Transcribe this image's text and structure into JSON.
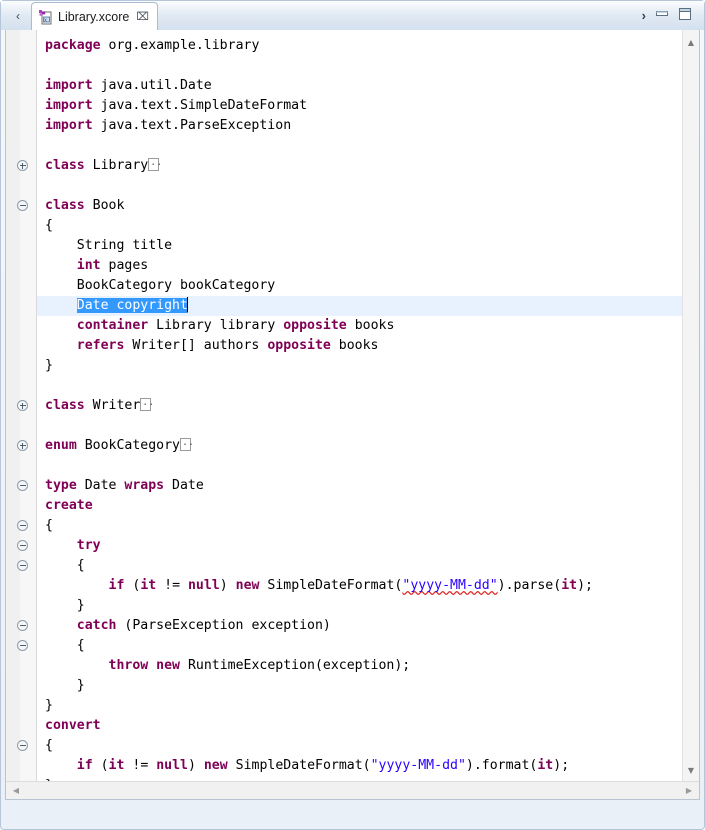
{
  "window": {
    "back_arrow": "‹",
    "overflow_chevron": "›",
    "minimize_label": "minimize",
    "maximize_label": "maximize"
  },
  "tab": {
    "label": "Library.xcore",
    "close_glyph": "⌧",
    "icon_name": "xcore-file-icon",
    "dirty": false
  },
  "editor": {
    "language": "xcore",
    "scroll": {
      "up_glyph": "▲",
      "down_glyph": "▼",
      "left_glyph": "◀",
      "right_glyph": "▶"
    },
    "colors": {
      "keyword": "#7F0055",
      "string": "#2A00FF",
      "selection_bg": "#3399FF",
      "selection_fg": "#FFFFFF",
      "current_line_bg": "#E8F2FE",
      "spellcheck_underline": "#E03030",
      "text": "#000000",
      "background": "#FFFFFF"
    },
    "selection": {
      "text": "Date copyright",
      "line": 11
    },
    "lines": [
      {
        "n": 1,
        "fold": null,
        "tokens": [
          {
            "t": "package ",
            "k": "kw"
          },
          {
            "t": "org.example.library"
          }
        ]
      },
      {
        "n": 2,
        "fold": null,
        "tokens": [
          {
            "t": ""
          }
        ]
      },
      {
        "n": 3,
        "fold": null,
        "tokens": [
          {
            "t": "import ",
            "k": "kw"
          },
          {
            "t": "java.util.Date"
          }
        ]
      },
      {
        "n": 4,
        "fold": null,
        "tokens": [
          {
            "t": "import ",
            "k": "kw"
          },
          {
            "t": "java.text.SimpleDateFormat"
          }
        ]
      },
      {
        "n": 5,
        "fold": null,
        "tokens": [
          {
            "t": "import ",
            "k": "kw"
          },
          {
            "t": "java.text.ParseException"
          }
        ]
      },
      {
        "n": 6,
        "fold": null,
        "tokens": [
          {
            "t": ""
          }
        ]
      },
      {
        "n": 7,
        "fold": "plus",
        "tokens": [
          {
            "t": "class ",
            "k": "kw"
          },
          {
            "t": "Library"
          },
          {
            "t": "",
            "k": "collapsed"
          }
        ]
      },
      {
        "n": 8,
        "fold": null,
        "tokens": [
          {
            "t": ""
          }
        ]
      },
      {
        "n": 9,
        "fold": "minus",
        "tokens": [
          {
            "t": "class ",
            "k": "kw"
          },
          {
            "t": "Book"
          }
        ]
      },
      {
        "n": 10,
        "fold": null,
        "tokens": [
          {
            "t": "{"
          }
        ]
      },
      {
        "n": 11,
        "fold": null,
        "tokens": [
          {
            "t": "    String title"
          }
        ]
      },
      {
        "n": 12,
        "fold": null,
        "tokens": [
          {
            "t": "    "
          },
          {
            "t": "int ",
            "k": "kw"
          },
          {
            "t": "pages"
          }
        ]
      },
      {
        "n": 13,
        "fold": null,
        "tokens": [
          {
            "t": "    BookCategory bookCategory"
          }
        ]
      },
      {
        "n": 14,
        "fold": null,
        "highlight": true,
        "tokens": [
          {
            "t": "    "
          },
          {
            "t": "Date copyright",
            "k": "sel"
          },
          {
            "t": "",
            "k": "caret"
          }
        ]
      },
      {
        "n": 15,
        "fold": null,
        "tokens": [
          {
            "t": "    "
          },
          {
            "t": "container ",
            "k": "kw"
          },
          {
            "t": "Library library "
          },
          {
            "t": "opposite ",
            "k": "kw"
          },
          {
            "t": "books"
          }
        ]
      },
      {
        "n": 16,
        "fold": null,
        "tokens": [
          {
            "t": "    "
          },
          {
            "t": "refers ",
            "k": "kw"
          },
          {
            "t": "Writer[] authors "
          },
          {
            "t": "opposite ",
            "k": "kw"
          },
          {
            "t": "books"
          }
        ]
      },
      {
        "n": 17,
        "fold": null,
        "tokens": [
          {
            "t": "}"
          }
        ]
      },
      {
        "n": 18,
        "fold": null,
        "tokens": [
          {
            "t": ""
          }
        ]
      },
      {
        "n": 19,
        "fold": "plus",
        "tokens": [
          {
            "t": "class ",
            "k": "kw"
          },
          {
            "t": "Writer"
          },
          {
            "t": "",
            "k": "collapsed"
          }
        ]
      },
      {
        "n": 20,
        "fold": null,
        "tokens": [
          {
            "t": ""
          }
        ]
      },
      {
        "n": 21,
        "fold": "plus",
        "tokens": [
          {
            "t": "enum ",
            "k": "kw"
          },
          {
            "t": "BookCategory"
          },
          {
            "t": "",
            "k": "collapsed"
          }
        ]
      },
      {
        "n": 22,
        "fold": null,
        "tokens": [
          {
            "t": ""
          }
        ]
      },
      {
        "n": 23,
        "fold": "minus",
        "tokens": [
          {
            "t": "type ",
            "k": "kw"
          },
          {
            "t": "Date "
          },
          {
            "t": "wraps ",
            "k": "kw"
          },
          {
            "t": "Date"
          }
        ]
      },
      {
        "n": 24,
        "fold": null,
        "tokens": [
          {
            "t": "create",
            "k": "kw"
          }
        ]
      },
      {
        "n": 25,
        "fold": "minus",
        "tokens": [
          {
            "t": "{"
          }
        ]
      },
      {
        "n": 26,
        "fold": "minus",
        "tokens": [
          {
            "t": "    "
          },
          {
            "t": "try",
            "k": "kw"
          }
        ]
      },
      {
        "n": 27,
        "fold": "minus",
        "tokens": [
          {
            "t": "    {"
          }
        ]
      },
      {
        "n": 28,
        "fold": null,
        "tokens": [
          {
            "t": "        "
          },
          {
            "t": "if ",
            "k": "kw"
          },
          {
            "t": "("
          },
          {
            "t": "it",
            "k": "kw"
          },
          {
            "t": " != "
          },
          {
            "t": "null",
            "k": "kw"
          },
          {
            "t": ") "
          },
          {
            "t": "new ",
            "k": "kw"
          },
          {
            "t": "SimpleDateFormat("
          },
          {
            "t": "\"yyyy-MM-dd\"",
            "k": "str-spell"
          },
          {
            "t": ").parse("
          },
          {
            "t": "it",
            "k": "kw"
          },
          {
            "t": ");"
          }
        ]
      },
      {
        "n": 29,
        "fold": null,
        "tokens": [
          {
            "t": "    }"
          }
        ]
      },
      {
        "n": 30,
        "fold": "minus",
        "tokens": [
          {
            "t": "    "
          },
          {
            "t": "catch ",
            "k": "kw"
          },
          {
            "t": "(ParseException exception)"
          }
        ]
      },
      {
        "n": 31,
        "fold": "minus",
        "tokens": [
          {
            "t": "    {"
          }
        ]
      },
      {
        "n": 32,
        "fold": null,
        "tokens": [
          {
            "t": "        "
          },
          {
            "t": "throw ",
            "k": "kw"
          },
          {
            "t": "new ",
            "k": "kw"
          },
          {
            "t": "RuntimeException(exception);"
          }
        ]
      },
      {
        "n": 33,
        "fold": null,
        "tokens": [
          {
            "t": "    }"
          }
        ]
      },
      {
        "n": 34,
        "fold": null,
        "tokens": [
          {
            "t": "}"
          }
        ]
      },
      {
        "n": 35,
        "fold": null,
        "tokens": [
          {
            "t": "convert",
            "k": "kw"
          }
        ]
      },
      {
        "n": 36,
        "fold": "minus",
        "tokens": [
          {
            "t": "{"
          }
        ]
      },
      {
        "n": 37,
        "fold": null,
        "tokens": [
          {
            "t": "    "
          },
          {
            "t": "if ",
            "k": "kw"
          },
          {
            "t": "("
          },
          {
            "t": "it",
            "k": "kw"
          },
          {
            "t": " != "
          },
          {
            "t": "null",
            "k": "kw"
          },
          {
            "t": ") "
          },
          {
            "t": "new ",
            "k": "kw"
          },
          {
            "t": "SimpleDateFormat("
          },
          {
            "t": "\"yyyy-MM-dd\"",
            "k": "str"
          },
          {
            "t": ").format("
          },
          {
            "t": "it",
            "k": "kw"
          },
          {
            "t": ");"
          }
        ]
      },
      {
        "n": 38,
        "fold": null,
        "tokens": [
          {
            "t": "}"
          }
        ]
      }
    ]
  }
}
